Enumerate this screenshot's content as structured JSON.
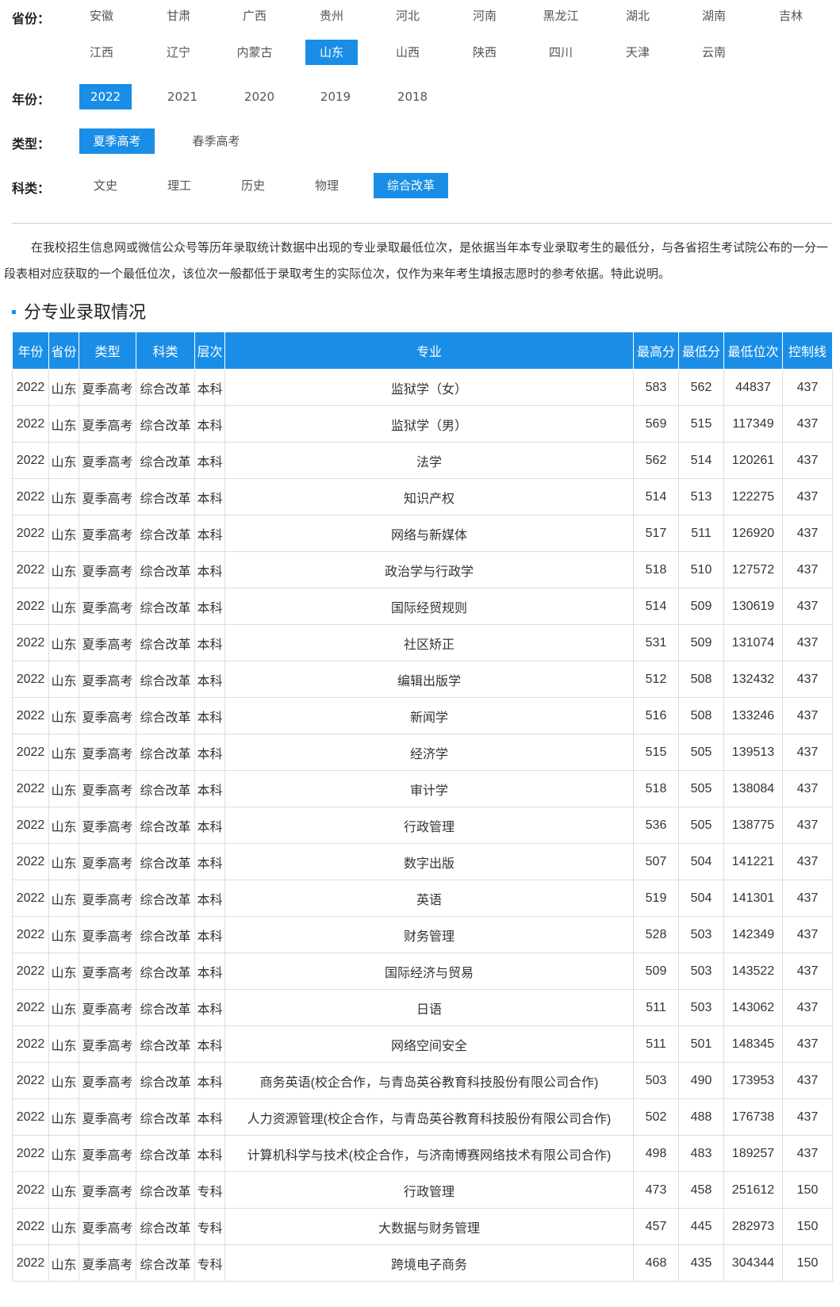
{
  "filters": {
    "province": {
      "label": "省份：",
      "row1": [
        "安徽",
        "甘肃",
        "广西",
        "贵州",
        "河北",
        "河南",
        "黑龙江",
        "湖北",
        "湖南",
        "吉林"
      ],
      "row2": [
        "江西",
        "辽宁",
        "内蒙古",
        "山东",
        "山西",
        "陕西",
        "四川",
        "天津",
        "云南"
      ],
      "selected": "山东"
    },
    "year": {
      "label": "年份：",
      "options": [
        "2022",
        "2021",
        "2020",
        "2019",
        "2018"
      ],
      "selected": "2022"
    },
    "type": {
      "label": "类型：",
      "options": [
        "夏季高考",
        "春季高考"
      ],
      "selected": "夏季高考"
    },
    "category": {
      "label": "科类：",
      "options": [
        "文史",
        "理工",
        "历史",
        "物理",
        "综合改革"
      ],
      "selected": "综合改革"
    }
  },
  "notice": "在我校招生信息网或微信公众号等历年录取统计数据中出现的专业录取最低位次，是依据当年本专业录取考生的最低分，与各省招生考试院公布的一分一段表相对应获取的一个最低位次，该位次一般都低于录取考生的实际位次，仅作为来年考生填报志愿时的参考依据。特此说明。",
  "section_title": "分专业录取情况",
  "table": {
    "headers": [
      "年份",
      "省份",
      "类型",
      "科类",
      "层次",
      "专业",
      "最高分",
      "最低分",
      "最低位次",
      "控制线"
    ],
    "rows": [
      [
        "2022",
        "山东",
        "夏季高考",
        "综合改革",
        "本科",
        "监狱学（女）",
        "583",
        "562",
        "44837",
        "437"
      ],
      [
        "2022",
        "山东",
        "夏季高考",
        "综合改革",
        "本科",
        "监狱学（男）",
        "569",
        "515",
        "117349",
        "437"
      ],
      [
        "2022",
        "山东",
        "夏季高考",
        "综合改革",
        "本科",
        "法学",
        "562",
        "514",
        "120261",
        "437"
      ],
      [
        "2022",
        "山东",
        "夏季高考",
        "综合改革",
        "本科",
        "知识产权",
        "514",
        "513",
        "122275",
        "437"
      ],
      [
        "2022",
        "山东",
        "夏季高考",
        "综合改革",
        "本科",
        "网络与新媒体",
        "517",
        "511",
        "126920",
        "437"
      ],
      [
        "2022",
        "山东",
        "夏季高考",
        "综合改革",
        "本科",
        "政治学与行政学",
        "518",
        "510",
        "127572",
        "437"
      ],
      [
        "2022",
        "山东",
        "夏季高考",
        "综合改革",
        "本科",
        "国际经贸规则",
        "514",
        "509",
        "130619",
        "437"
      ],
      [
        "2022",
        "山东",
        "夏季高考",
        "综合改革",
        "本科",
        "社区矫正",
        "531",
        "509",
        "131074",
        "437"
      ],
      [
        "2022",
        "山东",
        "夏季高考",
        "综合改革",
        "本科",
        "编辑出版学",
        "512",
        "508",
        "132432",
        "437"
      ],
      [
        "2022",
        "山东",
        "夏季高考",
        "综合改革",
        "本科",
        "新闻学",
        "516",
        "508",
        "133246",
        "437"
      ],
      [
        "2022",
        "山东",
        "夏季高考",
        "综合改革",
        "本科",
        "经济学",
        "515",
        "505",
        "139513",
        "437"
      ],
      [
        "2022",
        "山东",
        "夏季高考",
        "综合改革",
        "本科",
        "审计学",
        "518",
        "505",
        "138084",
        "437"
      ],
      [
        "2022",
        "山东",
        "夏季高考",
        "综合改革",
        "本科",
        "行政管理",
        "536",
        "505",
        "138775",
        "437"
      ],
      [
        "2022",
        "山东",
        "夏季高考",
        "综合改革",
        "本科",
        "数字出版",
        "507",
        "504",
        "141221",
        "437"
      ],
      [
        "2022",
        "山东",
        "夏季高考",
        "综合改革",
        "本科",
        "英语",
        "519",
        "504",
        "141301",
        "437"
      ],
      [
        "2022",
        "山东",
        "夏季高考",
        "综合改革",
        "本科",
        "财务管理",
        "528",
        "503",
        "142349",
        "437"
      ],
      [
        "2022",
        "山东",
        "夏季高考",
        "综合改革",
        "本科",
        "国际经济与贸易",
        "509",
        "503",
        "143522",
        "437"
      ],
      [
        "2022",
        "山东",
        "夏季高考",
        "综合改革",
        "本科",
        "日语",
        "511",
        "503",
        "143062",
        "437"
      ],
      [
        "2022",
        "山东",
        "夏季高考",
        "综合改革",
        "本科",
        "网络空间安全",
        "511",
        "501",
        "148345",
        "437"
      ],
      [
        "2022",
        "山东",
        "夏季高考",
        "综合改革",
        "本科",
        "商务英语(校企合作，与青岛英谷教育科技股份有限公司合作)",
        "503",
        "490",
        "173953",
        "437"
      ],
      [
        "2022",
        "山东",
        "夏季高考",
        "综合改革",
        "本科",
        "人力资源管理(校企合作，与青岛英谷教育科技股份有限公司合作)",
        "502",
        "488",
        "176738",
        "437"
      ],
      [
        "2022",
        "山东",
        "夏季高考",
        "综合改革",
        "本科",
        "计算机科学与技术(校企合作，与济南博赛网络技术有限公司合作)",
        "498",
        "483",
        "189257",
        "437"
      ],
      [
        "2022",
        "山东",
        "夏季高考",
        "综合改革",
        "专科",
        "行政管理",
        "473",
        "458",
        "251612",
        "150"
      ],
      [
        "2022",
        "山东",
        "夏季高考",
        "综合改革",
        "专科",
        "大数据与财务管理",
        "457",
        "445",
        "282973",
        "150"
      ],
      [
        "2022",
        "山东",
        "夏季高考",
        "综合改革",
        "专科",
        "跨境电子商务",
        "468",
        "435",
        "304344",
        "150"
      ]
    ]
  }
}
